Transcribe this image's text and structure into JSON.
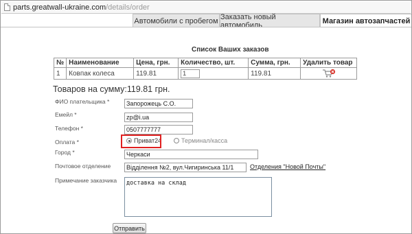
{
  "address_bar": {
    "host": "parts.greatwall-ukraine.com",
    "path": "/details/order"
  },
  "tabs": [
    {
      "label": "Автомобили с пробегом",
      "active": false
    },
    {
      "label": "Заказать новый автомобиль",
      "active": false
    },
    {
      "label": "Магазин автозапчастей",
      "active": true
    }
  ],
  "orders": {
    "title": "Список Ваших заказов",
    "columns": [
      "№",
      "Наименование",
      "Цена, грн.",
      "Количество, шт.",
      "Сумма, грн.",
      "Удалить товар"
    ],
    "rows": [
      {
        "num": "1",
        "name": "Ковпак колеса",
        "price": "119.81",
        "qty": "1",
        "sum": "119.81"
      }
    ],
    "remove_icon": "cart-remove-icon"
  },
  "total": {
    "label": "Товаров на сумму:",
    "value": "119.81 грн."
  },
  "form": {
    "fio_label": "ФИО плательщика *",
    "fio_value": "Запорожець С.О.",
    "email_label": "Емейл *",
    "email_value": "zp@i.ua",
    "phone_label": "Телефон *",
    "phone_value": "0507777777",
    "payment_label": "Оплата *",
    "payment_option1": "Приват24",
    "payment_option2": "Терминал/касса",
    "payment_selected": "Приват24",
    "city_label": "Город *",
    "city_value": "Черкаси",
    "post_label": "Почтовое отделение",
    "post_value": "Відділення №2, вул.Чигиринська 11/1",
    "post_link": "Отделения \"Новой Почты\"",
    "note_label": "Примечание заказчика",
    "note_value": "доставка на склад",
    "submit_label": "Отправить"
  },
  "colors": {
    "highlight": "#e02020",
    "remove_icon": "#d9342b"
  }
}
